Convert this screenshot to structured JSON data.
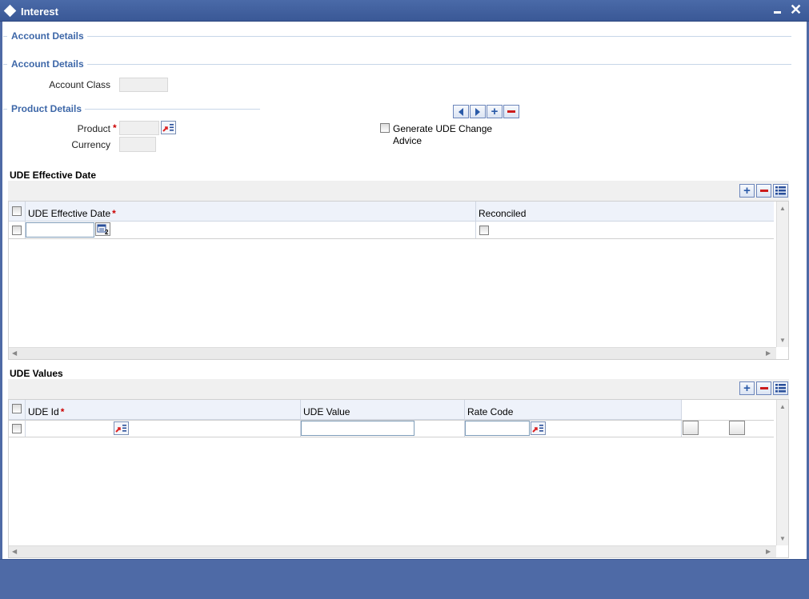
{
  "window": {
    "title": "Interest"
  },
  "sections": {
    "account_details_outer": "Account Details",
    "account_details": "Account Details",
    "product_details": "Product Details"
  },
  "account": {
    "class_label": "Account Class",
    "class_value": ""
  },
  "product": {
    "product_label": "Product",
    "product_required": "*",
    "product_value": "",
    "currency_label": "Currency",
    "currency_value": ""
  },
  "advice": {
    "label_line1": "Generate UDE Change",
    "label_line2": "Advice",
    "checked": false
  },
  "effective_date_grid": {
    "title": "UDE Effective Date",
    "columns": [
      {
        "label": "UDE Effective Date",
        "required": "*"
      },
      {
        "label": "Reconciled"
      }
    ],
    "rows": [
      {
        "date": "",
        "reconciled": false
      }
    ]
  },
  "values_grid": {
    "title": "UDE Values",
    "columns": [
      {
        "label": "UDE Id",
        "required": "*"
      },
      {
        "label": "UDE Value"
      },
      {
        "label": "Rate Code"
      }
    ],
    "rows": [
      {
        "ude_id": "",
        "ude_value": "",
        "rate_code": ""
      }
    ]
  },
  "icons": {
    "nav_prev": "triangle-left-icon",
    "nav_next": "triangle-right-icon",
    "add": "plus-icon",
    "delete": "minus-icon",
    "single_view": "list-icon",
    "lov": "lov-list-icon",
    "calendar": "calendar-icon"
  },
  "colors": {
    "titlebar": "#3f5f9e",
    "section_heading": "#3d67a8",
    "required": "#cc0000",
    "footer": "#4e6aa6"
  }
}
